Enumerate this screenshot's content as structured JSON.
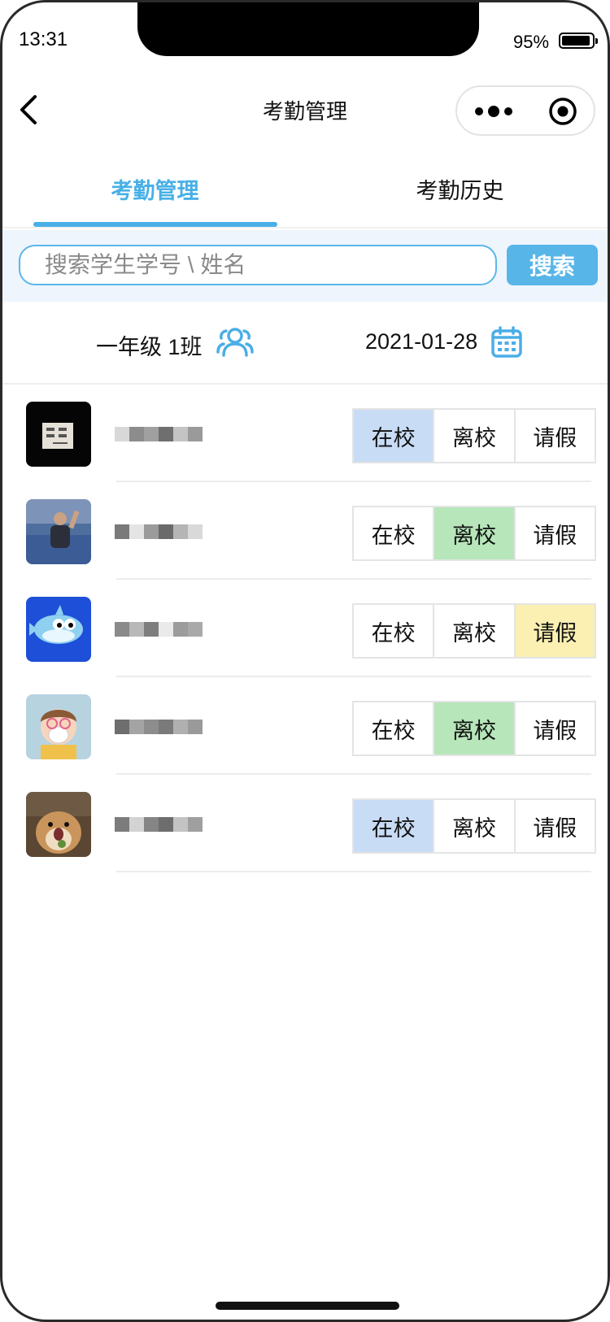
{
  "status_bar": {
    "time": "13:31",
    "battery": "95%"
  },
  "nav": {
    "title": "考勤管理"
  },
  "tabs": [
    {
      "label": "考勤管理",
      "active": true
    },
    {
      "label": "考勤历史",
      "active": false
    }
  ],
  "search": {
    "placeholder": "搜索学生学号 \\ 姓名",
    "button_label": "搜索"
  },
  "filter": {
    "class_name": "一年级 1班",
    "date": "2021-01-28"
  },
  "status_labels": {
    "school": "在校",
    "left": "离校",
    "leave": "请假"
  },
  "students": [
    {
      "avatar": "poster-avatar",
      "status": "在校"
    },
    {
      "avatar": "photo-avatar",
      "status": "离校"
    },
    {
      "avatar": "shark-avatar",
      "status": "请假"
    },
    {
      "avatar": "cartoon-kid-avatar",
      "status": "离校"
    },
    {
      "avatar": "hamster-avatar",
      "status": "在校"
    }
  ],
  "colors": {
    "accent": "#48b0e6",
    "school_selected": "#c9dcf6",
    "left_selected": "#b6e6b9",
    "leave_selected": "#fbefb2"
  }
}
